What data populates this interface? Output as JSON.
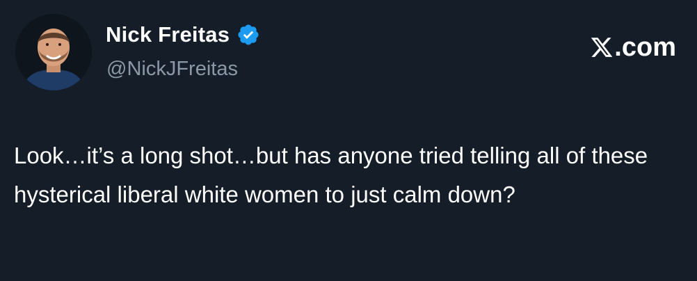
{
  "author": {
    "display_name": "Nick Freitas",
    "handle": "@NickJFreitas",
    "verified": true,
    "verified_icon": "verified-badge-icon",
    "avatar": "profile-photo"
  },
  "brand": {
    "icon": "x-logo-icon",
    "text": ".com"
  },
  "tweet": {
    "text": "Look…it’s a long shot…but has anyone tried telling all of these hysterical liberal white women to just calm down?"
  },
  "colors": {
    "background": "#151e28",
    "text": "#ffffff",
    "handle": "#8b98a5",
    "verified": "#1d9bf0"
  }
}
